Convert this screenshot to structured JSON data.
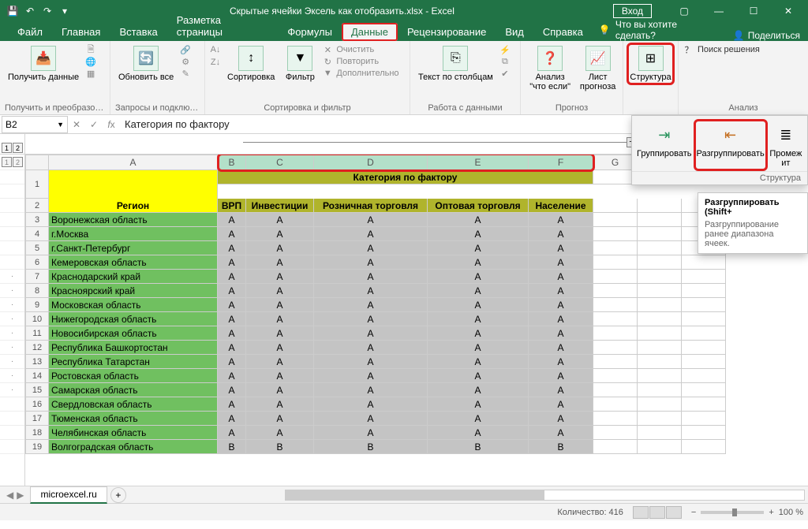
{
  "titlebar": {
    "filename": "Скрытые ячейки Эксель как отобразить.xlsx  -  Excel",
    "signin": "Вход"
  },
  "tabs": {
    "file": "Файл",
    "home": "Главная",
    "insert": "Вставка",
    "layout": "Разметка страницы",
    "formulas": "Формулы",
    "data": "Данные",
    "review": "Рецензирование",
    "view": "Вид",
    "help": "Справка",
    "tellme": "Что вы хотите сделать?",
    "share": "Поделиться"
  },
  "ribbon": {
    "get_data": "Получить\nданные",
    "group_get": "Получить и преобразов...",
    "refresh": "Обновить\nвсе",
    "group_queries": "Запросы и подключе...",
    "sort": "Сортировка",
    "filter": "Фильтр",
    "clear": "Очистить",
    "reapply": "Повторить",
    "advanced": "Дополнительно",
    "group_sortfilter": "Сортировка и фильтр",
    "text_to_cols": "Текст по\nстолбцам",
    "group_tools": "Работа с данными",
    "whatif": "Анализ \"что\nесли\"",
    "forecast_sheet": "Лист\nпрогноза",
    "group_forecast": "Прогноз",
    "structure": "Структура",
    "solver": "Поиск решения",
    "group_analysis": "Анализ"
  },
  "dropdown": {
    "group": "Группировать",
    "ungroup": "Разгруппировать",
    "subtotals": "Промеж\nит",
    "label": "Структура"
  },
  "tooltip": {
    "title": "Разгруппировать (Shift+",
    "body": "Разгруппирование ранее\nдиапазона ячеек."
  },
  "namebox": "B2",
  "formula": "Категория по фактору",
  "columns": [
    "A",
    "B",
    "C",
    "D",
    "E",
    "F",
    "G",
    "H",
    "I"
  ],
  "table": {
    "merged_title": "Категория по фактору",
    "region_header": "Регион",
    "col_headers": [
      "ВРП",
      "Инвестиции",
      "Розничная торговля",
      "Оптовая торговля",
      "Население"
    ],
    "rows": [
      {
        "n": 3,
        "region": "Воронежская область",
        "v": [
          "A",
          "A",
          "A",
          "A",
          "A"
        ]
      },
      {
        "n": 4,
        "region": "г.Москва",
        "v": [
          "A",
          "A",
          "A",
          "A",
          "A"
        ]
      },
      {
        "n": 5,
        "region": "г.Санкт-Петербург",
        "v": [
          "A",
          "A",
          "A",
          "A",
          "A"
        ]
      },
      {
        "n": 6,
        "region": "Кемеровская область",
        "v": [
          "A",
          "A",
          "A",
          "A",
          "A"
        ]
      },
      {
        "n": 7,
        "region": "Краснодарский край",
        "v": [
          "A",
          "A",
          "A",
          "A",
          "A"
        ]
      },
      {
        "n": 8,
        "region": "Красноярский край",
        "v": [
          "A",
          "A",
          "A",
          "A",
          "A"
        ]
      },
      {
        "n": 9,
        "region": "Московская область",
        "v": [
          "A",
          "A",
          "A",
          "A",
          "A"
        ]
      },
      {
        "n": 10,
        "region": "Нижегородская область",
        "v": [
          "A",
          "A",
          "A",
          "A",
          "A"
        ]
      },
      {
        "n": 11,
        "region": "Новосибирская область",
        "v": [
          "A",
          "A",
          "A",
          "A",
          "A"
        ]
      },
      {
        "n": 12,
        "region": "Республика Башкортостан",
        "v": [
          "A",
          "A",
          "A",
          "A",
          "A"
        ]
      },
      {
        "n": 13,
        "region": "Республика Татарстан",
        "v": [
          "A",
          "A",
          "A",
          "A",
          "A"
        ]
      },
      {
        "n": 14,
        "region": "Ростовская область",
        "v": [
          "A",
          "A",
          "A",
          "A",
          "A"
        ]
      },
      {
        "n": 15,
        "region": "Самарская область",
        "v": [
          "A",
          "A",
          "A",
          "A",
          "A"
        ]
      },
      {
        "n": 16,
        "region": "Свердловская область",
        "v": [
          "A",
          "A",
          "A",
          "A",
          "A"
        ]
      },
      {
        "n": 17,
        "region": "Тюменская область",
        "v": [
          "A",
          "A",
          "A",
          "A",
          "A"
        ]
      },
      {
        "n": 18,
        "region": "Челябинская область",
        "v": [
          "A",
          "A",
          "A",
          "A",
          "A"
        ]
      },
      {
        "n": 19,
        "region": "Волгоградская область",
        "v": [
          "B",
          "B",
          "B",
          "B",
          "B"
        ]
      }
    ]
  },
  "sheet": "microexcel.ru",
  "status": {
    "count": "Количество: 416",
    "zoom": "100 %"
  }
}
